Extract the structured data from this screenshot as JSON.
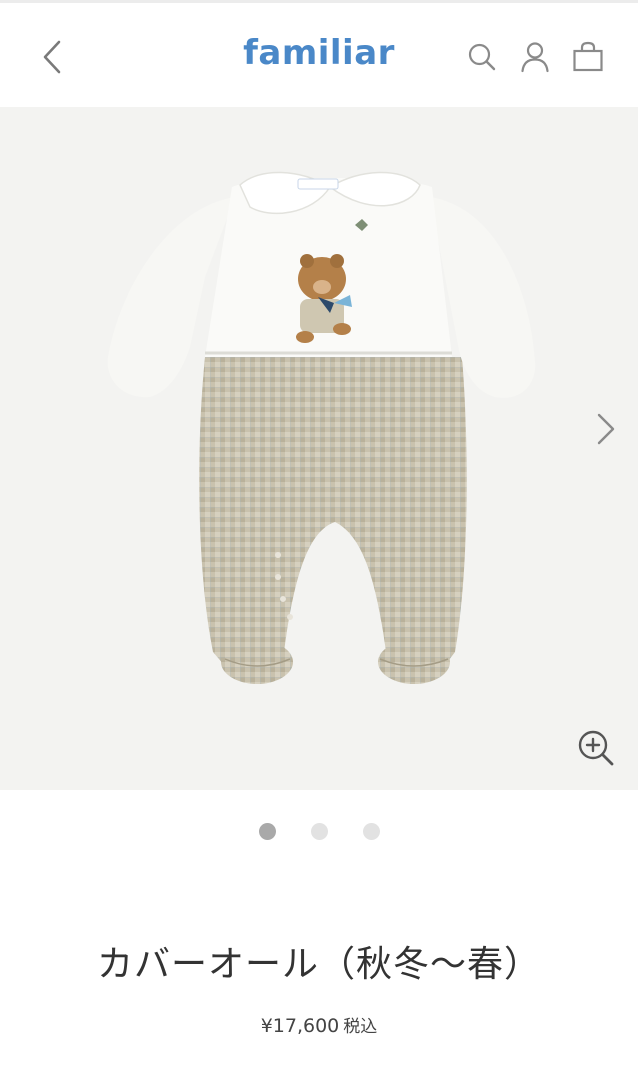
{
  "header": {
    "logo": "familiar",
    "back_icon": "chevron-left-icon",
    "icons": [
      "search-icon",
      "user-icon",
      "shopping-bag-icon"
    ]
  },
  "gallery": {
    "image_alt": "Baby coverall with white collared top, embroidered bear, and checked pants",
    "next_icon": "chevron-right-icon",
    "zoom_icon": "zoom-in-icon",
    "dots": [
      {
        "active": true
      },
      {
        "active": false
      },
      {
        "active": false
      }
    ]
  },
  "product": {
    "title": "カバーオール（秋冬〜春）",
    "price": "¥17,600",
    "tax_label": "税込"
  },
  "colors": {
    "brand": "#4a88c8",
    "background": "#f3f3f1",
    "dot_active": "#a9a9a9",
    "dot_inactive": "#e2e2e2"
  }
}
